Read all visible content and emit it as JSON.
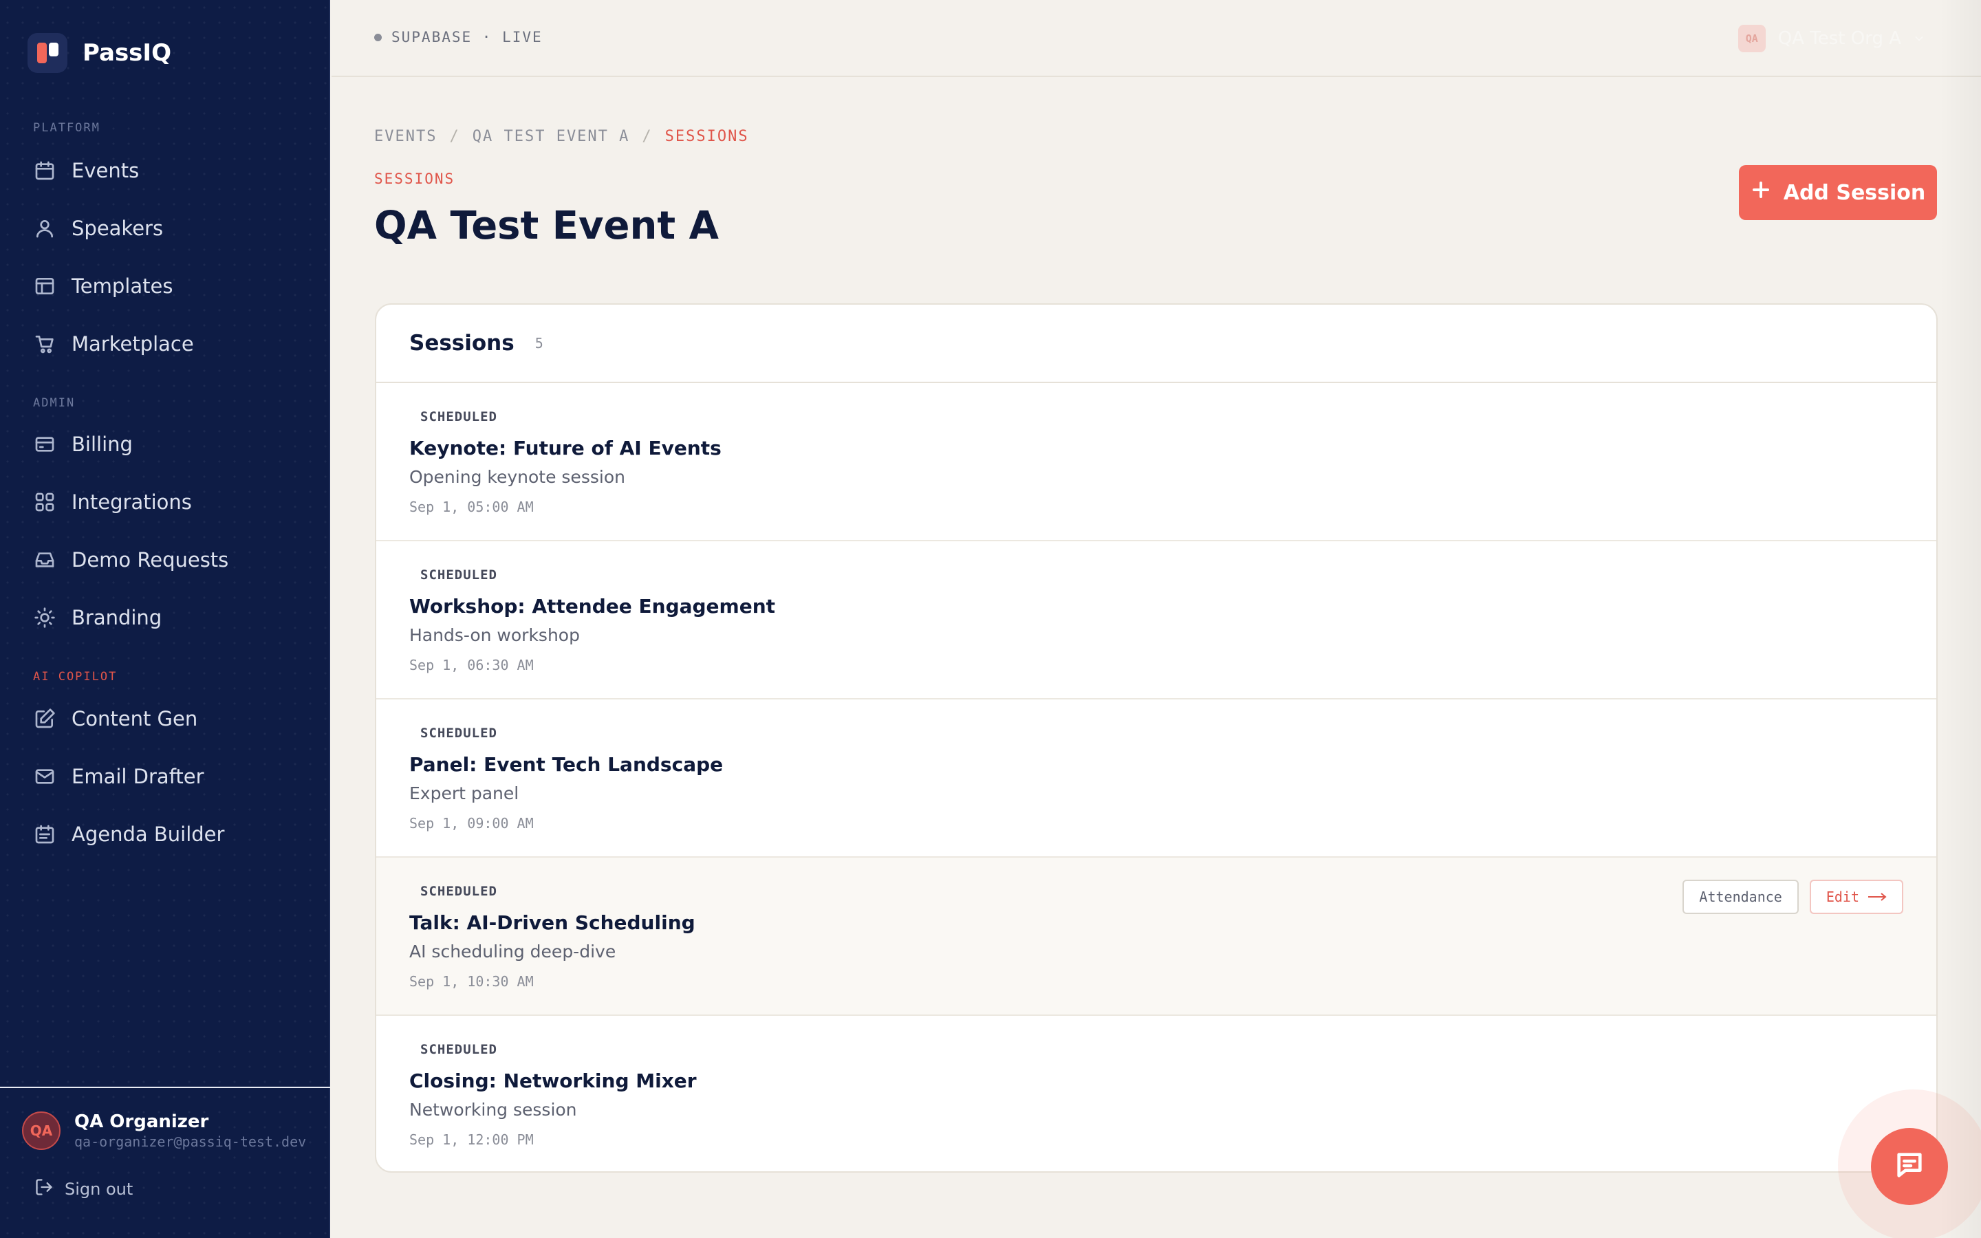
{
  "app": {
    "name": "PassIQ"
  },
  "sidebar": {
    "sections": [
      {
        "label": "PLATFORM"
      },
      {
        "label": "ADMIN"
      },
      {
        "label": "AI COPILOT"
      }
    ],
    "items": [
      {
        "label": "Events",
        "icon": "calendar-icon"
      },
      {
        "label": "Speakers",
        "icon": "user-icon"
      },
      {
        "label": "Templates",
        "icon": "layout-icon"
      },
      {
        "label": "Marketplace",
        "icon": "cart-icon"
      },
      {
        "label": "Billing",
        "icon": "credit-card-icon"
      },
      {
        "label": "Integrations",
        "icon": "grid-icon"
      },
      {
        "label": "Demo Requests",
        "icon": "inbox-icon"
      },
      {
        "label": "Branding",
        "icon": "sun-icon"
      },
      {
        "label": "Content Gen",
        "icon": "edit-icon"
      },
      {
        "label": "Email Drafter",
        "icon": "mail-icon"
      },
      {
        "label": "Agenda Builder",
        "icon": "calendar-list-icon"
      }
    ],
    "user": {
      "initials": "QA",
      "name": "QA Organizer",
      "email": "qa-organizer@passiq-test.dev"
    },
    "signout_label": "Sign out"
  },
  "topbar": {
    "status": "SUPABASE · LIVE",
    "org_badge": "QA",
    "org_name": "QA Test Org A"
  },
  "breadcrumb": [
    "EVENTS",
    "QA TEST EVENT A",
    "SESSIONS"
  ],
  "header": {
    "eyebrow": "SESSIONS",
    "title": "QA Test Event A",
    "add_button": "Add Session"
  },
  "sessions_card": {
    "title": "Sessions",
    "count": "5",
    "rows": [
      {
        "status": "SCHEDULED",
        "title": "Keynote: Future of AI Events",
        "description": "Opening keynote session",
        "time": "Sep 1, 05:00 AM"
      },
      {
        "status": "SCHEDULED",
        "title": "Workshop: Attendee Engagement",
        "description": "Hands-on workshop",
        "time": "Sep 1, 06:30 AM"
      },
      {
        "status": "SCHEDULED",
        "title": "Panel: Event Tech Landscape",
        "description": "Expert panel",
        "time": "Sep 1, 09:00 AM"
      },
      {
        "status": "SCHEDULED",
        "title": "Talk: AI-Driven Scheduling",
        "description": "AI scheduling deep-dive",
        "time": "Sep 1, 10:30 AM"
      },
      {
        "status": "SCHEDULED",
        "title": "Closing: Networking Mixer",
        "description": "Networking session",
        "time": "Sep 1, 12:00 PM"
      }
    ],
    "row_actions": {
      "attendance": "Attendance",
      "edit": "Edit"
    }
  },
  "colors": {
    "accent": "#f2675a",
    "sidebar_bg": "#0e1c45",
    "page_bg": "#f4f1ec"
  }
}
